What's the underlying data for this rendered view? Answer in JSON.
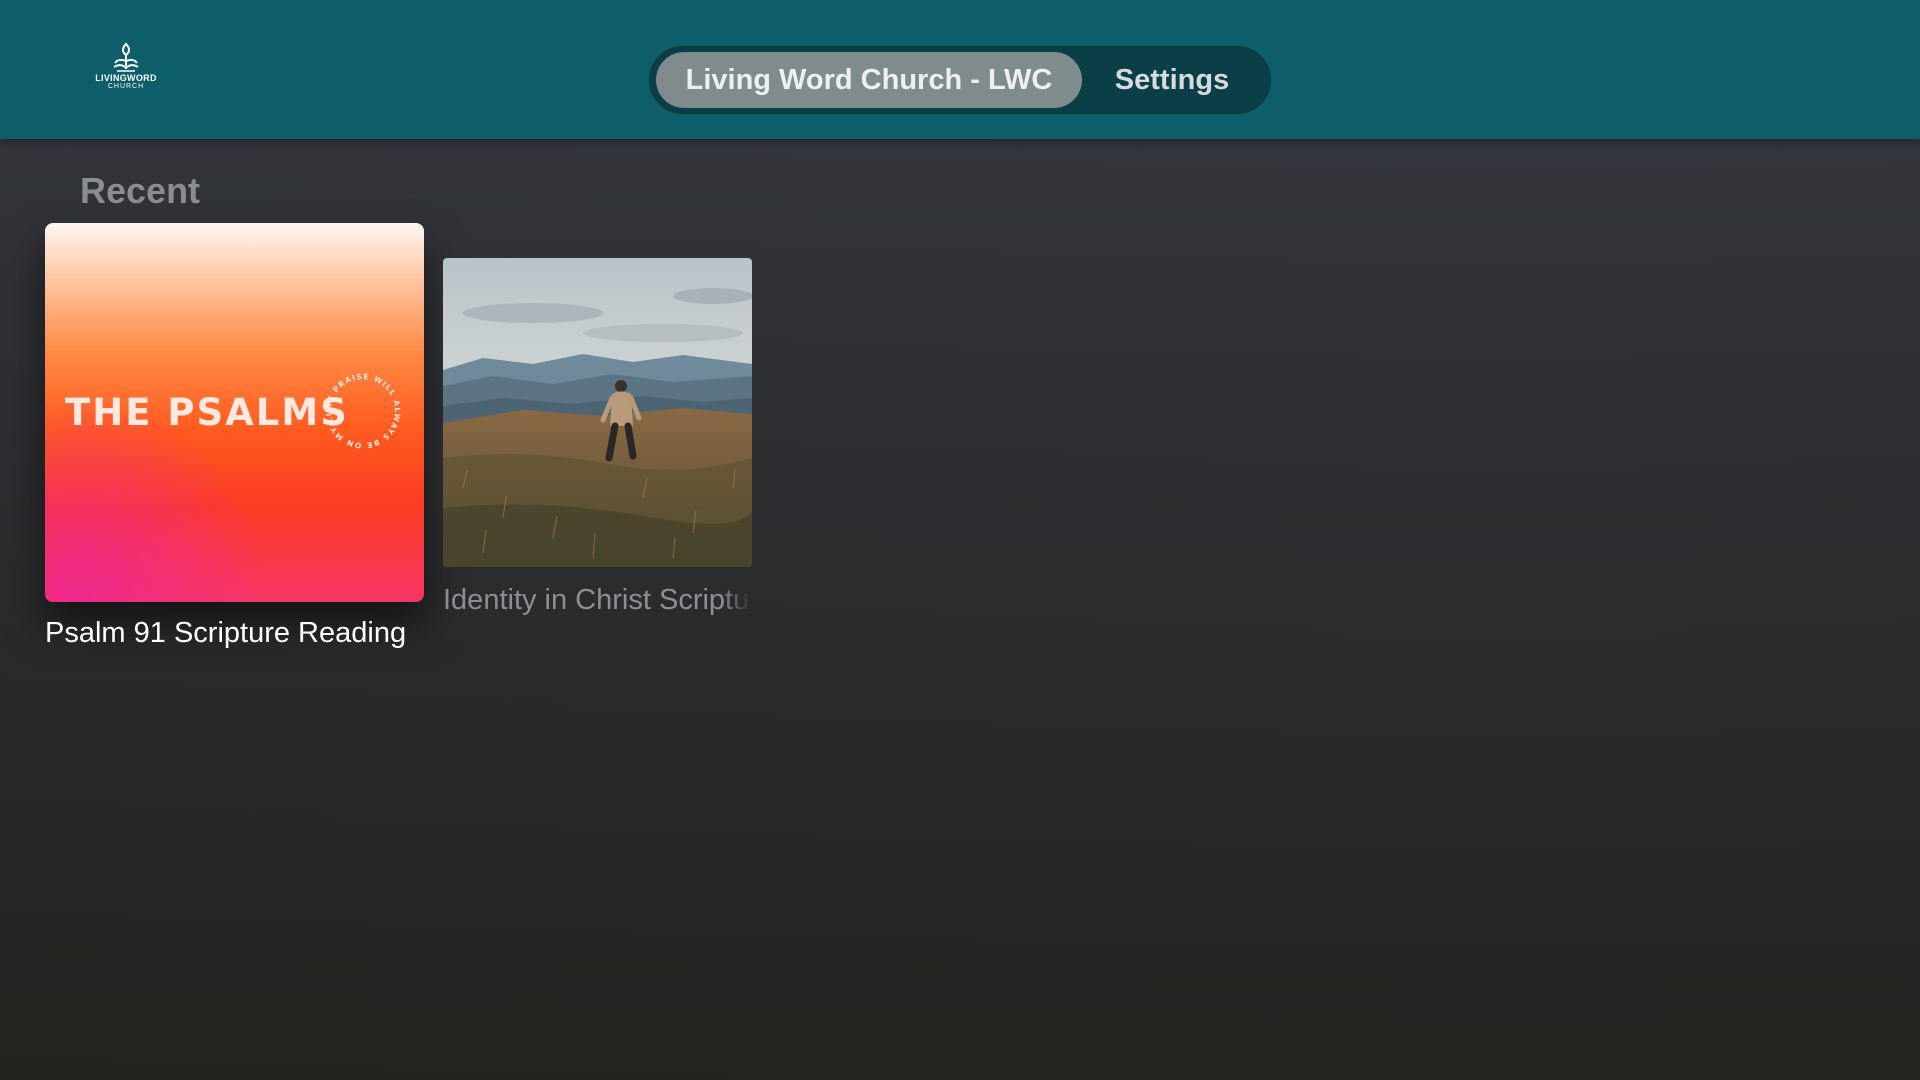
{
  "brand": {
    "logo_line1": "LIVINGWORD",
    "logo_line2": "CHURCH",
    "bar_color": "#0d5d6a"
  },
  "nav": {
    "tabs": [
      {
        "label": "Living Word Church - LWC",
        "active": true
      },
      {
        "label": "Settings",
        "active": false
      }
    ]
  },
  "recent": {
    "title": "Recent",
    "items": [
      {
        "title": "Psalm 91 Scripture Reading",
        "artwork_text": "THE PSALMS",
        "artwork_ring_text": "MY PRAISE WILL ALWAYS BE ON MY LIPS",
        "focused": true
      },
      {
        "title": "Identity in Christ Scripture Reading",
        "artwork": "person-walking-in-meadow-mountains",
        "focused": false
      }
    ]
  }
}
